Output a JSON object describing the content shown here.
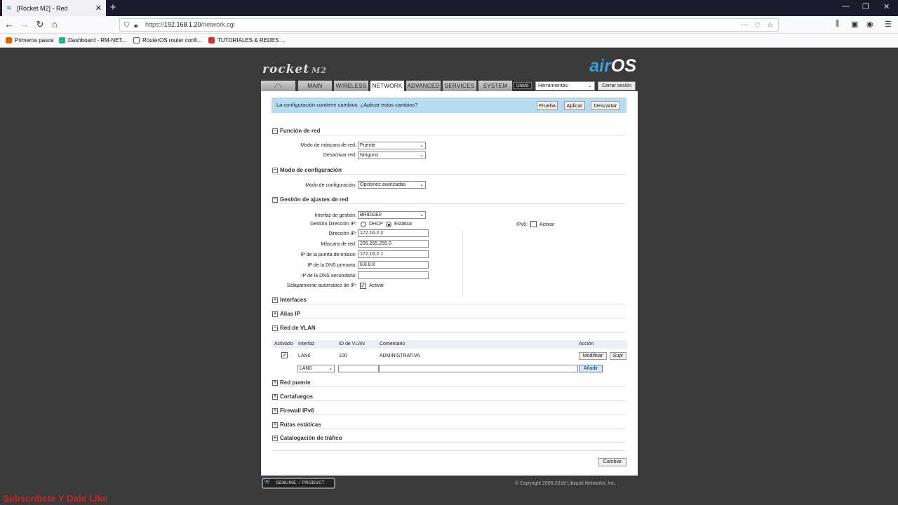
{
  "browser": {
    "tab_title": "[Rocket M2] - Red",
    "url_prefix": "https://",
    "url_host": "192.168.1.20",
    "url_path": "/network.cgi",
    "bookmarks": [
      "Primeros pasos",
      "Dashboard - RM-NET...",
      "RouterOS router confi...",
      "TUTORIALES & REDES ..."
    ]
  },
  "header": {
    "product": "rocket",
    "model": "M2",
    "brand_air": "air",
    "brand_os": "OS",
    "tabs": [
      "MAIN",
      "WIRELESS",
      "NETWORK",
      "ADVANCED",
      "SERVICES",
      "SYSTEM"
    ],
    "active_tab": "NETWORK",
    "unms": "UNMS",
    "tools_value": "Herramientas:",
    "logout": "Cerrar sesión"
  },
  "notice": {
    "text": "La configuración contiene cambios. ¿Aplicar estos cambios?",
    "test": "Prueba",
    "apply": "Aplicar",
    "discard": "Descartar"
  },
  "network_role": {
    "title": "Función de red",
    "mode_label": "Modo de máscara de red:",
    "mode_value": "Puente",
    "disable_label": "Desactivar red:",
    "disable_value": "Ninguno"
  },
  "config_mode": {
    "title": "Modo de configuración",
    "label": "Modo de configuración:",
    "value": "Opciones avanzadas"
  },
  "management": {
    "title": "Gestión de ajustes de red",
    "iface_label": "Interfaz de gestión:",
    "iface_value": "BRIDGE0",
    "ipmode_label": "Gestión Dirección IP:",
    "dhcp": "DHCP",
    "static": "Estática",
    "ip_label": "Dirección IP:",
    "ip_value": "172.16.2.2",
    "mask_label": "Máscara de red:",
    "mask_value": "255.255.255.0",
    "gw_label": "IP de la puerta de enlace:",
    "gw_value": "172.16.2.1",
    "dns1_label": "IP de la DNS primaria:",
    "dns1_value": "8.8.8.8",
    "dns2_label": "IP de la DNS secundaria:",
    "dns2_value": "",
    "alias_label": "Solapamiento automático de IP:",
    "activate": "Activar",
    "ipv6_label": "IPv6:",
    "ipv6_activate": "Activar"
  },
  "sections": {
    "interfaces": "Interfaces",
    "alias": "Alias IP",
    "vlan": "Red de VLAN",
    "bridge": "Red puente",
    "firewall": "Cortafuegos",
    "firewall6": "Firewall IPv6",
    "routes": "Rutas estáticas",
    "shaping": "Catalogación de tráfico"
  },
  "vlan_table": {
    "headers": {
      "enabled": "Activado",
      "iface": "Interfaz",
      "vlan_id": "ID de VLAN",
      "comment": "Comentario",
      "action": "Acción"
    },
    "row": {
      "iface": "LAN0",
      "vlan_id": "100",
      "comment": "ADMINISTRATIVA",
      "edit": "Modificar",
      "delete": "Supr"
    },
    "new_iface": "LAN0",
    "add": "Añadir"
  },
  "change_button": "Cambiar",
  "footer": {
    "genuine": "GENUINE ⟋ PRODUCT",
    "copyright": "© Copyright 2006-2018 Ubiquiti Networks, Inc."
  },
  "overlay_text": "Subscribete Y Dale Like"
}
